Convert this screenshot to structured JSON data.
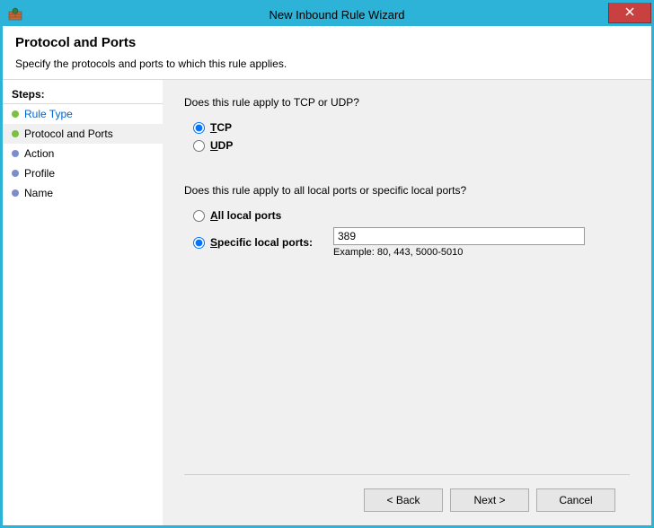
{
  "window": {
    "title": "New Inbound Rule Wizard"
  },
  "header": {
    "title": "Protocol and Ports",
    "subtitle": "Specify the protocols and ports to which this rule applies."
  },
  "sidebar": {
    "steps_label": "Steps:",
    "items": [
      {
        "label": "Rule Type",
        "state": "done",
        "link": true
      },
      {
        "label": "Protocol and Ports",
        "state": "done",
        "link": false,
        "active": true
      },
      {
        "label": "Action",
        "state": "pending",
        "link": false
      },
      {
        "label": "Profile",
        "state": "pending",
        "link": false
      },
      {
        "label": "Name",
        "state": "pending",
        "link": false
      }
    ]
  },
  "main": {
    "protocol_question": "Does this rule apply to TCP or UDP?",
    "protocol_options": {
      "tcp": {
        "label": "TCP",
        "underline": "T",
        "selected": true
      },
      "udp": {
        "label": "UDP",
        "underline": "U",
        "selected": false
      }
    },
    "ports_question": "Does this rule apply to all local ports or specific local ports?",
    "ports_options": {
      "all": {
        "label": "All local ports",
        "underline": "A",
        "selected": false
      },
      "specific": {
        "label": "Specific local ports:",
        "underline": "S",
        "selected": true
      }
    },
    "specific_ports_value": "389",
    "example_text": "Example: 80, 443, 5000-5010"
  },
  "footer": {
    "back": "< Back",
    "next": "Next >",
    "cancel": "Cancel"
  }
}
